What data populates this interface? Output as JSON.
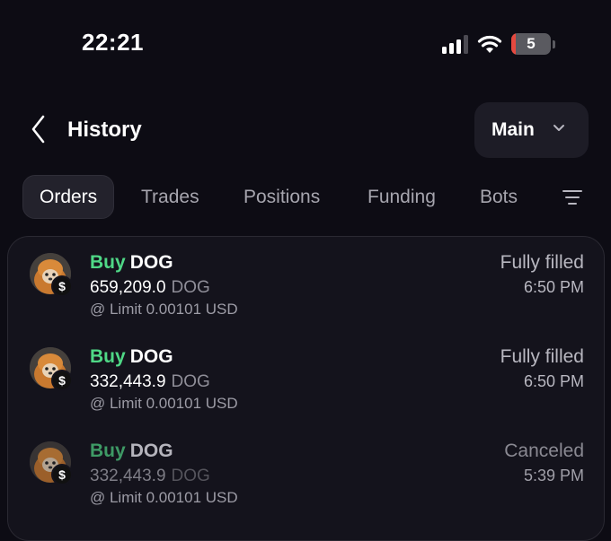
{
  "status_bar": {
    "time": "22:21",
    "battery_level": "5",
    "icons": [
      "cellular-signal-icon",
      "wifi-icon",
      "battery-icon"
    ]
  },
  "header": {
    "title": "History",
    "account_selector": "Main",
    "icons": [
      "back-chevron-icon",
      "chevron-down-icon"
    ]
  },
  "tabs": [
    {
      "label": "Orders",
      "active": true
    },
    {
      "label": "Trades",
      "active": false
    },
    {
      "label": "Positions",
      "active": false
    },
    {
      "label": "Funding",
      "active": false
    },
    {
      "label": "Bots",
      "active": false
    }
  ],
  "filter_icon": "filter-lines-icon",
  "orders": [
    {
      "side": "Buy",
      "symbol": "DOG",
      "quantity": "659,209.0",
      "unit": "DOG",
      "price_line": "@ Limit 0.00101 USD",
      "status": "Fully filled",
      "time": "6:50 PM"
    },
    {
      "side": "Buy",
      "symbol": "DOG",
      "quantity": "332,443.9",
      "unit": "DOG",
      "price_line": "@ Limit 0.00101 USD",
      "status": "Fully filled",
      "time": "6:50 PM"
    },
    {
      "side": "Buy",
      "symbol": "DOG",
      "quantity": "332,443.9",
      "unit": "DOG",
      "price_line": "@ Limit 0.00101 USD",
      "status": "Canceled",
      "time": "5:39 PM"
    }
  ],
  "colors": {
    "background": "#0d0c14",
    "buy": "#4fd886",
    "panel": "#14131c",
    "battery_low": "#e5493f"
  }
}
